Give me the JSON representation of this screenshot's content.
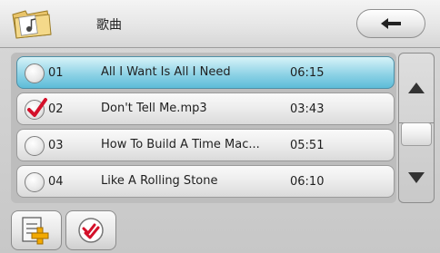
{
  "header": {
    "title": "歌曲"
  },
  "icons": {
    "folder": "folder-music-icon",
    "back": "back-arrow-icon",
    "add": "add-playlist-icon",
    "select_all": "select-all-check-icon",
    "scroll_up": "triangle-up-icon",
    "scroll_down": "triangle-down-icon"
  },
  "colors": {
    "selected_row": "#8fd3e6",
    "checkmark": "#d4102a"
  },
  "songs": [
    {
      "num": "01",
      "name": "All I Want Is All I Need",
      "duration": "06:15",
      "checked": false,
      "highlighted": true
    },
    {
      "num": "02",
      "name": "Don't Tell Me.mp3",
      "duration": "03:43",
      "checked": true,
      "highlighted": false
    },
    {
      "num": "03",
      "name": "How To Build A Time Mac...",
      "duration": "05:51",
      "checked": false,
      "highlighted": false
    },
    {
      "num": "04",
      "name": "Like A Rolling Stone",
      "duration": "06:10",
      "checked": false,
      "highlighted": false
    }
  ]
}
